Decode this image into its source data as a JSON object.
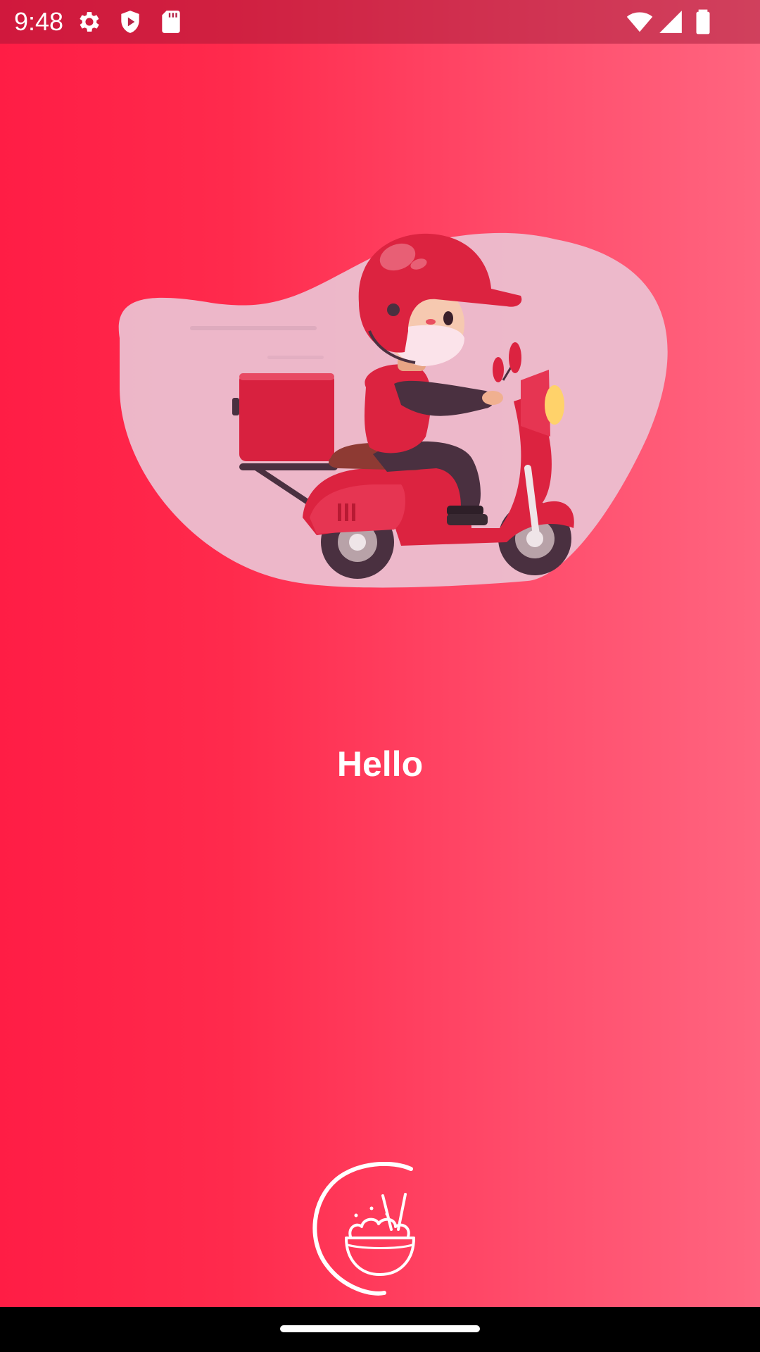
{
  "status_bar": {
    "time": "9:48",
    "left_icons": [
      "gear-icon",
      "shield-play-icon",
      "sd-card-icon"
    ],
    "right_icons": [
      "wifi-icon",
      "signal-icon",
      "battery-icon"
    ]
  },
  "main": {
    "illustration": "delivery-scooter-rider",
    "greeting": "Hello",
    "logo": "food-bowl-logo"
  },
  "colors": {
    "gradient_start": "#ff1d45",
    "gradient_end": "#ff6580",
    "blob": "#ecbfd0",
    "accent_red": "#dc2340",
    "dark": "#4a3040",
    "text": "#ffffff"
  }
}
